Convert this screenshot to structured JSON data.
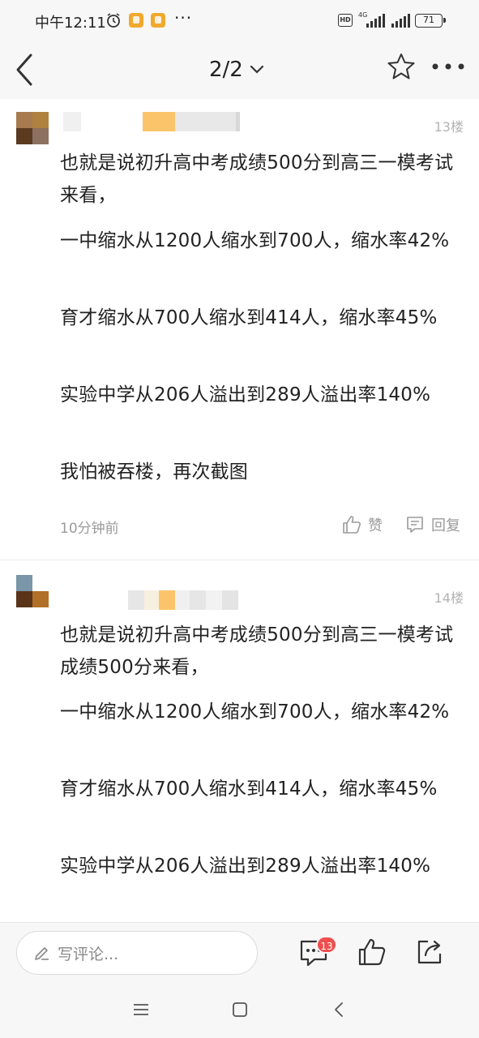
{
  "status": {
    "time": "中午12:11",
    "more_dots": "···",
    "hd_label": "HD",
    "network_label": "4G",
    "battery": "71"
  },
  "nav": {
    "page_indicator": "2/2",
    "back_icon": "back-arrow-icon",
    "dropdown_icon": "chevron-down-icon",
    "favorite_icon": "star-icon",
    "more_icon": "more-dots-icon"
  },
  "posts": [
    {
      "floor": "13楼",
      "paragraphs": [
        "也就是说初升高中考成绩500分到高三一模考试来看，",
        "一中缩水从1200人缩水到700人，缩水率42%",
        "育才缩水从700人缩水到414人，缩水率45%",
        "实验中学从206人溢出到289人溢出率140%",
        "我怕被吞楼，再次截图"
      ],
      "time_ago": "10分钟前",
      "like_label": "赞",
      "reply_label": "回复"
    },
    {
      "floor": "14楼",
      "paragraphs": [
        "也就是说初升高中考成绩500分到高三一模考试成绩500分来看，",
        "一中缩水从1200人缩水到700人，缩水率42%",
        "育才缩水从700人缩水到414人，缩水率45%",
        "实验中学从206人溢出到289人溢出率140%"
      ]
    }
  ],
  "bottom_bar": {
    "comment_placeholder": "写评论...",
    "comment_count": "13"
  },
  "colors": {
    "background": "#ffffff",
    "bar_background": "#f7f7f7",
    "badge_red": "#ef4e4e",
    "muted_text": "#9a9a9a"
  }
}
